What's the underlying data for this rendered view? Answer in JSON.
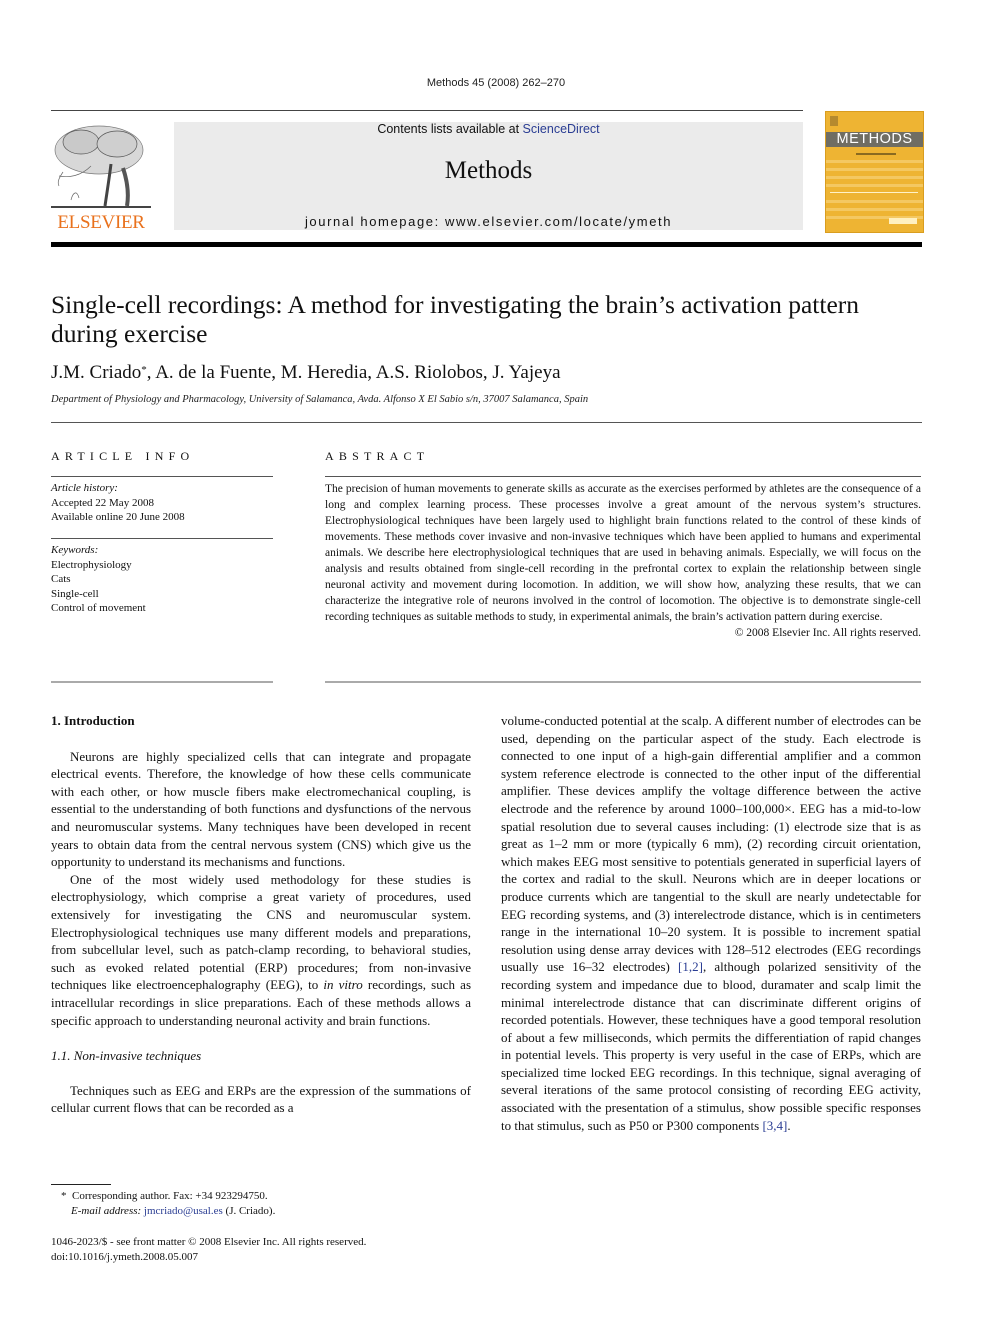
{
  "header": {
    "running_head": "Methods 45 (2008) 262–270",
    "contents_prefix": "Contents lists available at ",
    "sciencedirect_link": "ScienceDirect",
    "journal_title": "Methods",
    "homepage": "journal homepage: www.elsevier.com/locate/ymeth",
    "publisher_logo_text": "ELSEVIER",
    "cover_title": "METHODS",
    "colors": {
      "publisher_orange": "#e9711c",
      "link_blue": "#2a3d93",
      "cover_yellow": "#eeb433",
      "masthead_gray": "#ebebeb"
    }
  },
  "article": {
    "title_line1": "Single-cell recordings: A method for investigating the brain’s activation pattern",
    "title_line2": "during exercise",
    "authors_first": "J.M. Criado",
    "authors_marker": "*",
    "authors_rest": ", A. de la Fuente, M. Heredia, A.S. Riolobos, J. Yajeya",
    "affiliation": "Department of Physiology and Pharmacology, University of Salamanca, Avda. Alfonso X El Sabio s/n, 37007 Salamanca, Spain"
  },
  "article_info": {
    "heading": "ARTICLE INFO",
    "history_label": "Article history:",
    "history": [
      "Accepted 22 May 2008",
      "Available online 20 June 2008"
    ],
    "keywords_label": "Keywords:",
    "keywords": [
      "Electrophysiology",
      "Cats",
      "Single-cell",
      "Control of movement"
    ]
  },
  "abstract": {
    "heading": "ABSTRACT",
    "text": "The precision of human movements to generate skills as accurate as the exercises performed by athletes are the consequence of a long and complex learning process. These processes involve a great amount of the nervous system’s structures. Electrophysiological techniques have been largely used to highlight brain functions related to the control of these kinds of movements. These methods cover invasive and non-invasive techniques which have been applied to humans and experimental animals. We describe here electrophysiological techniques that are used in behaving animals. Especially, we will focus on the analysis and results obtained from single-cell recording in the prefrontal cortex to explain the relationship between single neuronal activity and movement during locomotion. In addition, we will show how, analyzing these results, that we can characterize the integrative role of neurons involved in the control of locomotion. The objective is to demonstrate single-cell recording techniques as suitable methods to study, in experimental animals, the brain’s activation pattern during exercise.",
    "copyright": "© 2008 Elsevier Inc. All rights reserved."
  },
  "body": {
    "section1_heading": "1. Introduction",
    "p1": "Neurons are highly specialized cells that can integrate and propagate electrical events. Therefore, the knowledge of how these cells communicate with each other, or how muscle fibers make electromechanical coupling, is essential to the understanding of both functions and dysfunctions of the nervous and neuromuscular systems. Many techniques have been developed in recent years to obtain data from the central nervous system (CNS) which give us the opportunity to understand its mechanisms and functions.",
    "p2_a": "One of the most widely used methodology for these studies is electrophysiology, which comprise a great variety of procedures, used extensively for investigating the CNS and neuromuscular system. Electrophysiological techniques use many different models and preparations, from subcellular level, such as patch-clamp recording, to behavioral studies, such as evoked related potential (ERP) procedures; from non-invasive techniques like electroencephalography (EEG), to ",
    "p2_italic": "in vitro",
    "p2_b": " recordings, such as intracellular recordings in slice preparations. Each of these methods allows a specific approach to understanding neuronal activity and brain functions.",
    "subsection_heading": "1.1. Non-invasive techniques",
    "p3_left": "Techniques such as EEG and ERPs are the expression of the summations of cellular current flows that can be recorded as a",
    "p3_right_a": "volume-conducted potential at the scalp. A different number of electrodes can be used, depending on the particular aspect of the study. Each electrode is connected to one input of a high-gain differential amplifier and a common system reference electrode is connected to the other input of the differential amplifier. These devices amplify the voltage difference between the active electrode and the reference by around 1000–100,000×. EEG has a mid-to-low spatial resolution due to several causes including: (1) electrode size that is as great as 1–2 mm or more (typically 6 mm), (2) recording circuit orientation, which makes EEG most sensitive to potentials generated in superficial layers of the cortex and radial to the skull. Neurons which are in deeper locations or produce currents which are tangential to the skull are nearly undetectable for EEG recording systems, and (3) interelectrode distance, which is in centimeters range in the international 10–20 system. It is possible to increment spatial resolution using dense array devices with 128–512 electrodes (EEG recordings usually use 16–32 electrodes) ",
    "ref1": "[1,2]",
    "p3_right_b": ", although polarized sensitivity of the recording system and impedance due to blood, duramater and scalp limit the minimal interelectrode distance that can discriminate different origins of recorded potentials. However, these techniques have a good temporal resolution of about a few milliseconds, which permits the differentiation of rapid changes in potential levels. This property is very useful in the case of ERPs, which are specialized time locked EEG recordings. In this technique, signal averaging of several iterations of the same protocol consisting of recording EEG activity, associated with the presentation of a stimulus, show possible specific responses to that stimulus, such as P50 or P300 components ",
    "ref2": "[3,4]",
    "p3_right_end": "."
  },
  "footnotes": {
    "marker": "*",
    "corresponding": "Corresponding author. Fax: +34 923294750.",
    "email_label": "E-mail address:",
    "email": "jmcriado@usal.es",
    "email_suffix": " (J. Criado).",
    "issn_line": "1046-2023/$ - see front matter © 2008 Elsevier Inc. All rights reserved.",
    "doi": "doi:10.1016/j.ymeth.2008.05.007"
  }
}
